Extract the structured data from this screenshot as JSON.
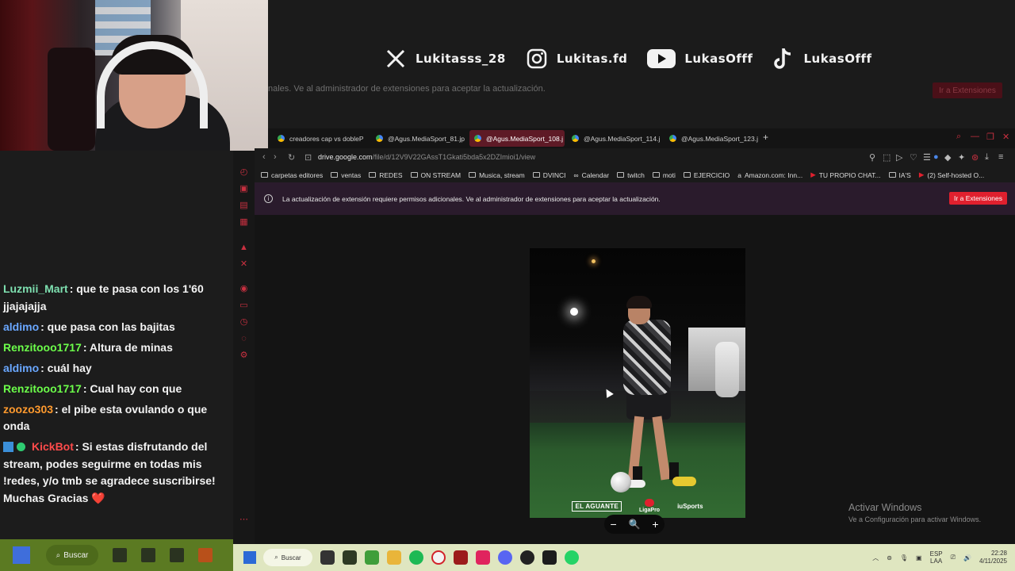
{
  "ghost": {
    "notice": "nales. Ve al administrador de extensiones para aceptar la actualización.",
    "button": "Ir a Extensiones"
  },
  "socials": [
    {
      "icon": "x-logo-icon",
      "handle": "Lukitasss_28"
    },
    {
      "icon": "instagram-logo-icon",
      "handle": "Lukitas.fd"
    },
    {
      "icon": "youtube-logo-icon",
      "handle": "LukasOfff"
    },
    {
      "icon": "tiktok-logo-icon",
      "handle": "LukasOfff"
    }
  ],
  "chat": [
    {
      "user": "Luzmii_Mart",
      "color": "#7ee0b0",
      "text": ": que te pasa con los 1'60 jjajajajja"
    },
    {
      "user": "aldimo",
      "color": "#6aa7ff",
      "text": ": que pasa con las bajitas"
    },
    {
      "user": "Renzitooo1717",
      "color": "#6cff4a",
      "text": ": Altura de minas"
    },
    {
      "user": "aldimo",
      "color": "#6aa7ff",
      "text": ": cuál hay"
    },
    {
      "user": "Renzitooo1717",
      "color": "#6cff4a",
      "text": ": Cual hay con que"
    },
    {
      "user": "zoozo303",
      "color": "#ff9a2e",
      "text": ": el pibe esta ovulando o que onda"
    },
    {
      "user": "KickBot",
      "color": "#ff4b4b",
      "text": ": Si estas disfrutando del stream, podes seguirme en todas mis !redes, y/o tmb se agradece suscribirse! Muchas Gracias ❤️",
      "badges": true
    }
  ],
  "tabs": [
    {
      "label": "creadores cap vs dobleP"
    },
    {
      "label": "@Agus.MediaSport_81.jp"
    },
    {
      "label": "@Agus.MediaSport_108.j"
    },
    {
      "label": "@Agus.MediaSport_114.j"
    },
    {
      "label": "@Agus.MediaSport_123.j"
    }
  ],
  "active_tab": 2,
  "url": {
    "host": "drive.google.com",
    "path": "/file/d/12V9V22GAssT1Gkati5bda5x2DZImioi1/view"
  },
  "bookmarks": [
    "carpetas editores",
    "ventas",
    "REDES",
    "ON STREAM",
    "Musica, stream",
    "DVINCI",
    "Calendar",
    "twitch",
    "moti",
    "EJERCICIO",
    "Amazon.com: Inn...",
    "TU PROPIO CHAT...",
    "IA'S",
    "(2) Self-hosted O..."
  ],
  "notice": {
    "message": "La actualización de extensión requiere permisos adicionales. Ve al administrador de extensiones para aceptar la actualización.",
    "button": "Ir a Extensiones"
  },
  "photo_logos": {
    "left": "EL AGUANTE",
    "center": "LigaPro",
    "right": "iuSports"
  },
  "zoom": {
    "minus": "−",
    "icon": "🔍",
    "plus": "+"
  },
  "activate": {
    "title": "Activar Windows",
    "subtitle": "Ve a Configuración para activar Windows."
  },
  "taskbar": {
    "search_left": "Buscar",
    "search_right": "Buscar",
    "lang_top": "ESP",
    "lang_bottom": "LAA",
    "time": "22:28",
    "date": "4/11/2025"
  }
}
